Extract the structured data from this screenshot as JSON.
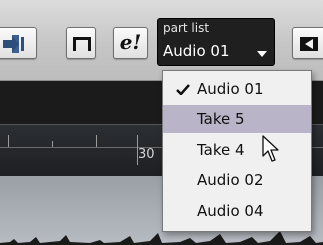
{
  "toolbar": {
    "edit_glyph": "e!",
    "part_list": {
      "label": "part list",
      "value": "Audio 01"
    }
  },
  "ruler": {
    "marker_label": "30"
  },
  "part_menu": {
    "items": [
      {
        "label": "Audio 01",
        "checked": true,
        "highlighted": false
      },
      {
        "label": "Take 5",
        "checked": false,
        "highlighted": true
      },
      {
        "label": "Take 4",
        "checked": false,
        "highlighted": false
      },
      {
        "label": "Audio 02",
        "checked": false,
        "highlighted": false
      },
      {
        "label": "Audio 04",
        "checked": false,
        "highlighted": false
      }
    ]
  },
  "colors": {
    "toolbar_bg": "#c8c8c8",
    "partlist_bg": "#1f1f1f",
    "menu_bg": "#f0f0f0",
    "menu_highlight": "#b9b4c8",
    "track_dark": "#1b1b1b",
    "lane_bg": "#a9aeb4"
  },
  "icons": [
    "split-icon",
    "window-icon",
    "next-arrow-icon",
    "checkmark-icon",
    "mouse-pointer-icon"
  ]
}
